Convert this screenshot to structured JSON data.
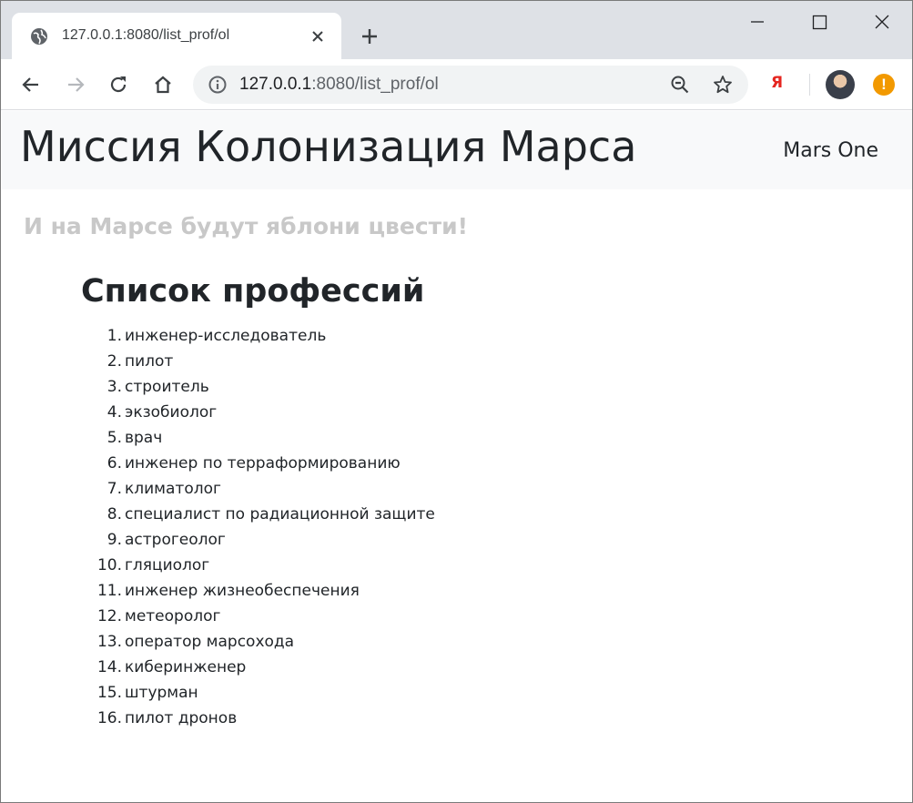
{
  "browser": {
    "tab_title": "127.0.0.1:8080/list_prof/ol",
    "url_host": "127.0.0.1",
    "url_rest": ":8080/list_prof/ol",
    "extension_label": "Я",
    "alert_label": "!"
  },
  "page": {
    "brand": "Миссия Колонизация Марса",
    "nav_link": "Mars One",
    "slogan": "И на Марсе будут яблони цвести!",
    "list_title": "Список профессий",
    "professions": [
      {
        "num": "1.",
        "text": "инженер-исследователь"
      },
      {
        "num": "2.",
        "text": "пилот"
      },
      {
        "num": "3.",
        "text": "строитель"
      },
      {
        "num": "4.",
        "text": "экзобиолог"
      },
      {
        "num": "5.",
        "text": "врач"
      },
      {
        "num": "6.",
        "text": "инженер по терраформированию"
      },
      {
        "num": "7.",
        "text": "климатолог"
      },
      {
        "num": "8.",
        "text": "специалист по радиационной защите"
      },
      {
        "num": "9.",
        "text": "астрогеолог"
      },
      {
        "num": "10.",
        "text": "гляциолог"
      },
      {
        "num": "11.",
        "text": "инженер жизнеобеспечения"
      },
      {
        "num": "12.",
        "text": "метеоролог"
      },
      {
        "num": "13.",
        "text": "оператор марсохода"
      },
      {
        "num": "14.",
        "text": "киберинженер"
      },
      {
        "num": "15.",
        "text": "штурман"
      },
      {
        "num": "16.",
        "text": "пилот дронов"
      }
    ]
  },
  "colors": {
    "tabstrip_bg": "#dee1e6",
    "navbar_bg": "#f8f9fa",
    "slogan": "#c8c8c8",
    "text": "#212529",
    "accent_alert": "#f29900",
    "yandex_red": "#e52620"
  }
}
